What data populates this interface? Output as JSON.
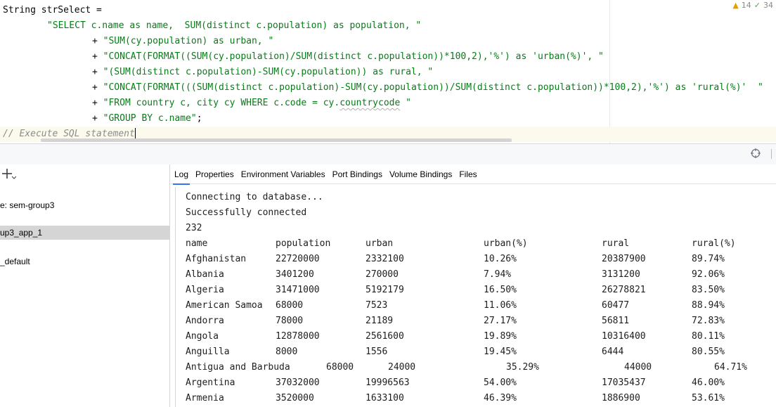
{
  "editor": {
    "lines": [
      {
        "plain": "String strSelect =",
        "str": ""
      },
      {
        "plain": "",
        "str": "\"SELECT c.name as name,  SUM(distinct c.population) as population, \""
      },
      {
        "plain": "+ ",
        "str": "\"SUM(cy.population) as urban, \""
      },
      {
        "plain": "+ ",
        "str": "\"CONCAT(FORMAT((SUM(cy.population)/SUM(distinct c.population))*100,2),'%') as 'urban(%)', \""
      },
      {
        "plain": "+ ",
        "str": "\"(SUM(distinct c.population)-SUM(cy.population)) as rural, \""
      },
      {
        "plain": "+ ",
        "str": "\"CONCAT(FORMAT(((SUM(distinct c.population)-SUM(cy.population))/SUM(distinct c.population))*100,2),'%') as 'rural(%)'  \""
      },
      {
        "plain": "+ ",
        "str": "\"FROM country c, city cy WHERE c.code = cy.countrycode \""
      },
      {
        "plain": "+ ",
        "str": "\"GROUP BY c.name\"",
        "tail": ";"
      }
    ],
    "comment": "// Execute SQL statement",
    "warnings": "14",
    "checks": "34"
  },
  "left_panel": {
    "items": [
      {
        "label": "e: sem-group3",
        "selected": false
      },
      {
        "label": "up3_app_1",
        "selected": true
      },
      {
        "label": "_default",
        "selected": false
      }
    ]
  },
  "tabs": [
    "Log",
    "Properties",
    "Environment Variables",
    "Port Bindings",
    "Volume Bindings",
    "Files"
  ],
  "log": {
    "connecting": "Connecting to database...",
    "connected": "Successfully connected",
    "count": "232",
    "headers": [
      "name",
      "population",
      "urban",
      "urban(%)",
      "rural",
      "rural(%)"
    ],
    "rows": [
      [
        "Afghanistan",
        "22720000",
        "2332100",
        "10.26%",
        "20387900",
        "89.74%"
      ],
      [
        "Albania",
        "3401200",
        "270000",
        "7.94%",
        "3131200",
        "92.06%"
      ],
      [
        "Algeria",
        "31471000",
        "5192179",
        "16.50%",
        "26278821",
        "83.50%"
      ],
      [
        "American Samoa",
        "68000",
        "7523",
        "11.06%",
        "60477",
        "88.94%"
      ],
      [
        "Andorra",
        "78000",
        "21189",
        "27.17%",
        "56811",
        "72.83%"
      ],
      [
        "Angola",
        "12878000",
        "2561600",
        "19.89%",
        "10316400",
        "80.11%"
      ],
      [
        "Anguilla",
        "8000",
        "1556",
        "19.45%",
        "6444",
        "80.55%"
      ],
      [
        "Antigua and Barbuda",
        "68000",
        "24000",
        "35.29%",
        "44000",
        "64.71%"
      ],
      [
        "Argentina",
        "37032000",
        "19996563",
        "54.00%",
        "17035437",
        "46.00%"
      ],
      [
        "Armenia",
        "3520000",
        "1633100",
        "46.39%",
        "1886900",
        "53.61%"
      ]
    ]
  }
}
